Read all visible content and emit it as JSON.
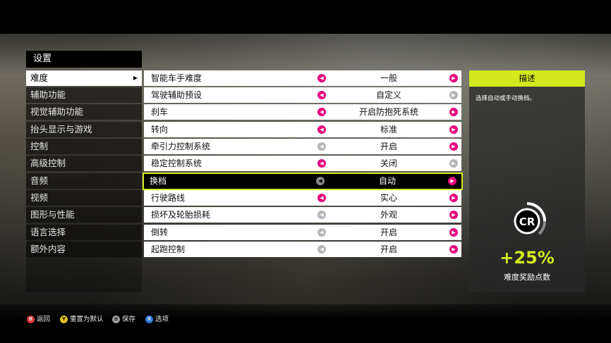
{
  "menu": {
    "title": "设置",
    "items": [
      {
        "label": "难度",
        "active": true
      },
      {
        "label": "辅助功能"
      },
      {
        "label": "视觉辅助功能"
      },
      {
        "label": "抬头显示与游戏"
      },
      {
        "label": "控制"
      },
      {
        "label": "高级控制"
      },
      {
        "label": "音频"
      },
      {
        "label": "视频"
      },
      {
        "label": "图形与性能"
      },
      {
        "label": "语言选择"
      },
      {
        "label": "额外内容"
      }
    ]
  },
  "settings": [
    {
      "label": "智能车手难度",
      "value": "一般",
      "left_enabled": true,
      "right_enabled": true
    },
    {
      "label": "驾驶辅助预设",
      "value": "自定义",
      "left_enabled": true,
      "right_enabled": false
    },
    {
      "label": "刹车",
      "value": "开启防抱死系统",
      "left_enabled": true,
      "right_enabled": true
    },
    {
      "label": "转向",
      "value": "标准",
      "left_enabled": true,
      "right_enabled": true
    },
    {
      "label": "牵引力控制系统",
      "value": "开启",
      "left_enabled": false,
      "right_enabled": true
    },
    {
      "label": "稳定控制系统",
      "value": "关闭",
      "left_enabled": true,
      "right_enabled": false
    },
    {
      "label": "换档",
      "value": "自动",
      "left_enabled": false,
      "right_enabled": true,
      "selected": true
    },
    {
      "label": "行驶路线",
      "value": "实心",
      "left_enabled": true,
      "right_enabled": true
    },
    {
      "label": "损坏及轮胎损耗",
      "value": "外观",
      "left_enabled": false,
      "right_enabled": true
    },
    {
      "label": "倒转",
      "value": "开启",
      "left_enabled": false,
      "right_enabled": true
    },
    {
      "label": "起跑控制",
      "value": "开启",
      "left_enabled": false,
      "right_enabled": true
    }
  ],
  "description": {
    "title": "描述",
    "text": "选择自动或手动换档。",
    "cr_badge": "CR",
    "bonus": "+25%",
    "bonus_label": "难度奖励点数"
  },
  "footer": [
    {
      "button": "B",
      "color": "#e0343c",
      "label": "返回"
    },
    {
      "button": "Y",
      "color": "#e8c21a",
      "label": "重置为默认"
    },
    {
      "button": "≡",
      "color": "#9a9a9a",
      "label": "保存"
    },
    {
      "button": "X",
      "color": "#2d7be0",
      "label": "选项"
    }
  ],
  "colors": {
    "accent_lime": "#d2ea1d",
    "arrow_magenta": "#e6007e",
    "arrow_disabled": "#b5b5b5"
  }
}
